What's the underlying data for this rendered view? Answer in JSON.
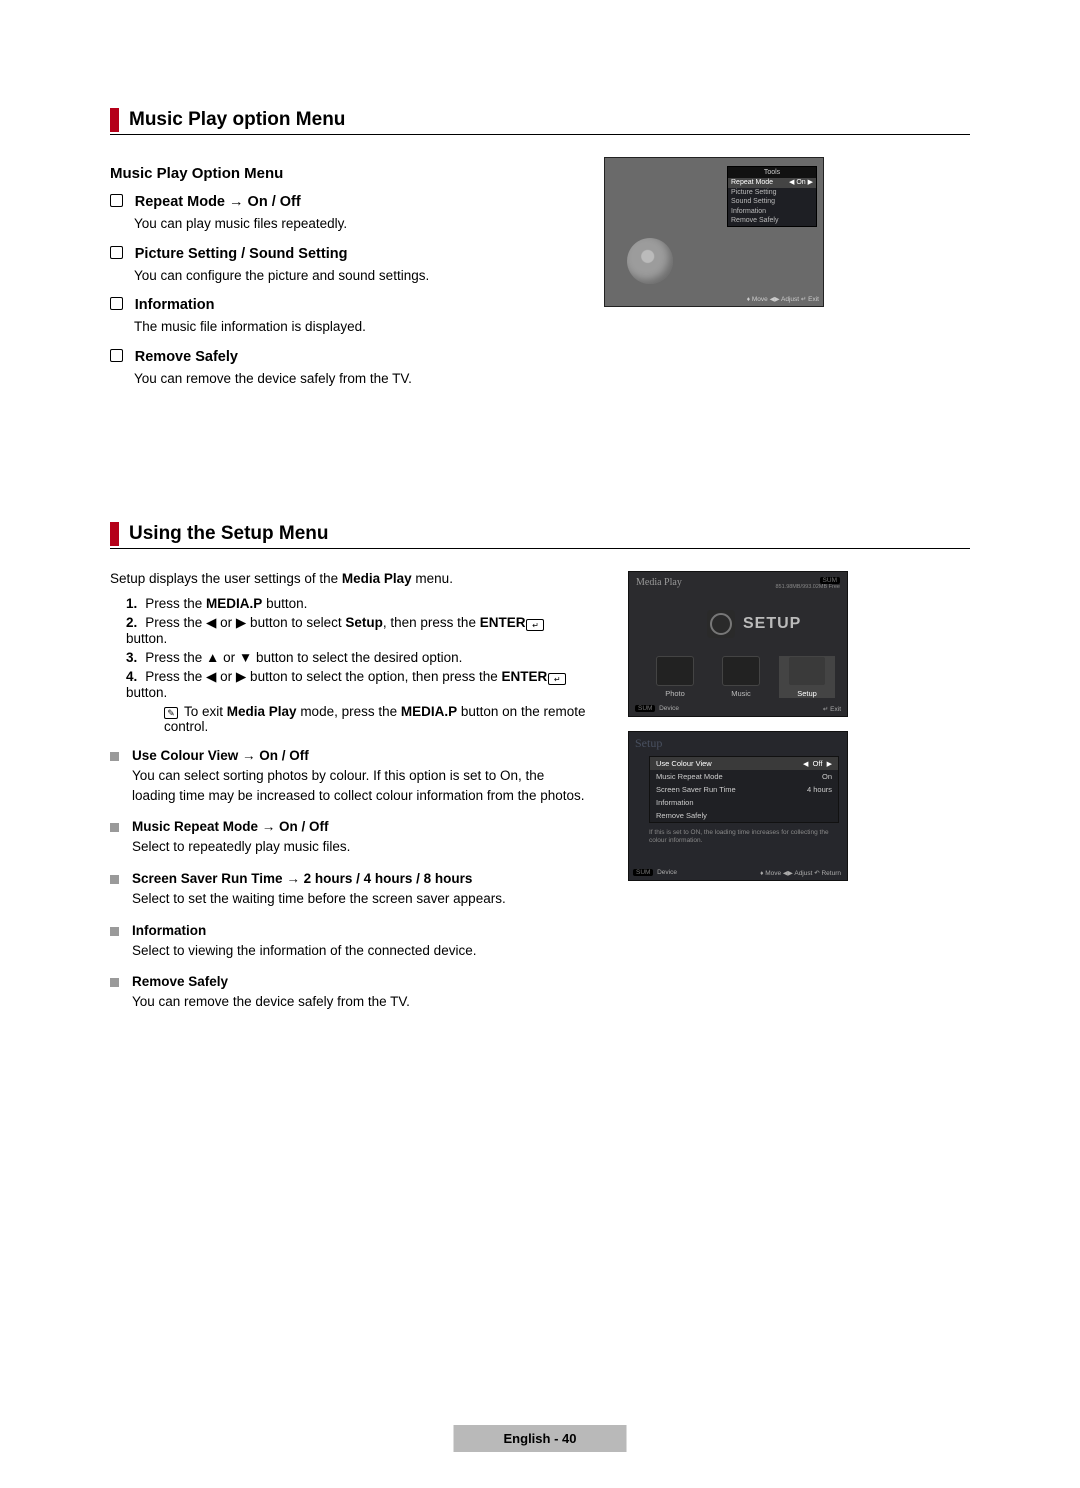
{
  "section1": {
    "title": "Music Play option Menu",
    "sub": "Music Play Option Menu",
    "items": [
      {
        "title": "Repeat Mode → On / Off",
        "body": "You can play music files repeatedly."
      },
      {
        "title": "Picture Setting / Sound Setting",
        "body": "You can configure the picture and sound settings."
      },
      {
        "title": "Information",
        "body": "The music file information is displayed."
      },
      {
        "title": "Remove Safely",
        "body": "You can remove the device safely from the TV."
      }
    ]
  },
  "tools_menu": {
    "title": "Tools",
    "rows": [
      "Repeat Mode",
      "Picture Setting",
      "Sound Setting",
      "Information",
      "Remove Safely"
    ],
    "selected_value": "On",
    "footer": "♦ Move   ◀▶ Adjust   ↵ Exit"
  },
  "section2": {
    "title": "Using the Setup Menu",
    "intro_pre": "Setup displays the user settings of the ",
    "intro_bold": "Media Play",
    "intro_post": " menu.",
    "steps": {
      "s1_pre": "Press the ",
      "s1_bold": "MEDIA.P",
      "s1_post": " button.",
      "s2_pre": "Press the ◀ or ▶ button to select ",
      "s2_bold1": "Setup",
      "s2_mid": ", then press the ",
      "s2_bold2": "ENTER",
      "s2_post": " button.",
      "s3": "Press the ▲ or ▼ button to select the desired option.",
      "s4_pre": "Press the ◀ or ▶ button to select the option, then press the ",
      "s4_bold": "ENTER",
      "s4_post": " button.",
      "note_pre": "To exit ",
      "note_b1": "Media Play",
      "note_mid": " mode, press the ",
      "note_b2": "MEDIA.P",
      "note_post": " button on the remote control."
    },
    "bullets": [
      {
        "title": "Use Colour View → On / Off",
        "body": "You can select sorting photos by colour. If this option is set to On, the loading time may be increased to collect colour information from the photos."
      },
      {
        "title": "Music Repeat Mode → On / Off",
        "body": "Select to repeatedly play music files."
      },
      {
        "title": "Screen Saver Run Time → 2 hours / 4 hours / 8 hours",
        "body": "Select to set the waiting time before the screen saver appears."
      },
      {
        "title": "Information",
        "body": "Select to viewing the information of the connected device."
      },
      {
        "title": "Remove Safely",
        "body": "You can remove the device safely from the TV."
      }
    ]
  },
  "media_play_shot": {
    "title": "Media Play",
    "sum": "SUM",
    "usb": "851.98MB/993.02MB Free",
    "big": "SETUP",
    "cats": [
      "Photo",
      "Music",
      "Setup"
    ],
    "bar_left": "SUM    Device",
    "bar_right": "↵ Exit"
  },
  "setup_list_shot": {
    "hdr": "Setup",
    "rows": [
      {
        "label": "Use Colour View",
        "value": "Off",
        "sel": true
      },
      {
        "label": "Music Repeat Mode",
        "value": "On"
      },
      {
        "label": "Screen Saver Run Time",
        "value": "4 hours"
      },
      {
        "label": "Information",
        "value": ""
      },
      {
        "label": "Remove Safely",
        "value": ""
      }
    ],
    "note": "If this is set to ON, the loading time increases for collecting the colour information.",
    "bar_l": "SUM    Device",
    "bar_r": "♦ Move   ◀▶ Adjust   ↶ Return"
  },
  "footer": "English - 40"
}
